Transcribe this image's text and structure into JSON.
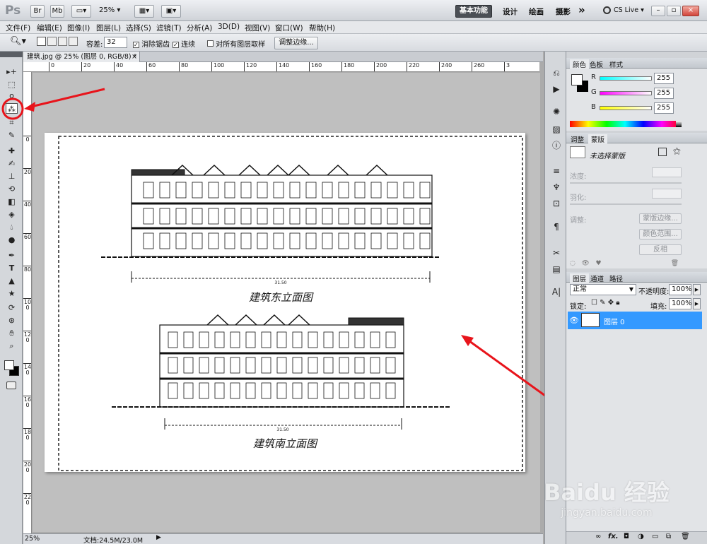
{
  "app": {
    "logo": "Ps",
    "zoom": "25%"
  },
  "workspaces": {
    "active": "基本功能",
    "items": [
      "设计",
      "绘画",
      "摄影"
    ],
    "more": "»",
    "cslive": "CS Live"
  },
  "menu": [
    "文件(F)",
    "编辑(E)",
    "图像(I)",
    "图层(L)",
    "选择(S)",
    "滤镜(T)",
    "分析(A)",
    "3D(D)",
    "视图(V)",
    "窗口(W)",
    "帮助(H)"
  ],
  "options": {
    "tolerance_label": "容差:",
    "tolerance_value": "32",
    "antialias": "消除锯齿",
    "contiguous": "连续",
    "sample_all": "对所有图层取样",
    "refine": "调整边缘..."
  },
  "document": {
    "tab": "建筑.jpg @ 25% (图层 0, RGB/8) *",
    "close": "×"
  },
  "ruler_h": [
    "0",
    "20",
    "40",
    "60",
    "80",
    "100",
    "120",
    "140",
    "160",
    "180",
    "200",
    "220",
    "240",
    "260",
    "3"
  ],
  "ruler_v": [
    "0",
    "20",
    "40",
    "60",
    "80",
    "100",
    "120",
    "140",
    "160",
    "180",
    "200",
    "220"
  ],
  "drawing": {
    "title1": "建筑东立面图",
    "title2": "建筑南立面图",
    "dim1": "31.50",
    "dim2": "31.50"
  },
  "color_panel": {
    "tabs": [
      "颜色",
      "色板",
      "样式"
    ],
    "channels": [
      {
        "label": "R",
        "value": "255"
      },
      {
        "label": "G",
        "value": "255"
      },
      {
        "label": "B",
        "value": "255"
      }
    ]
  },
  "mask_panel": {
    "tabs": [
      "调整",
      "蒙版"
    ],
    "no_selection": "未选择蒙版",
    "density": "浓度:",
    "feather": "羽化:",
    "refine": "调整:",
    "edge_btn": "蒙版边缘...",
    "color_range": "颜色范围...",
    "invert": "反相"
  },
  "layers_panel": {
    "tabs": [
      "图层",
      "通道",
      "路径"
    ],
    "blend": "正常",
    "opacity_label": "不透明度:",
    "opacity_value": "100%",
    "lock_label": "锁定:",
    "fill_label": "填充:",
    "fill_value": "100%",
    "layer_name": "图层 0",
    "footer": "fx."
  },
  "status": {
    "zoom": "25%",
    "doc": "文档:24.5M/23.0M"
  },
  "watermark": {
    "brand": "Baidu 经验",
    "url": "jingyan.baidu.com"
  },
  "colors": {
    "accent": "#3399ff",
    "annotation": "#e8141b"
  }
}
